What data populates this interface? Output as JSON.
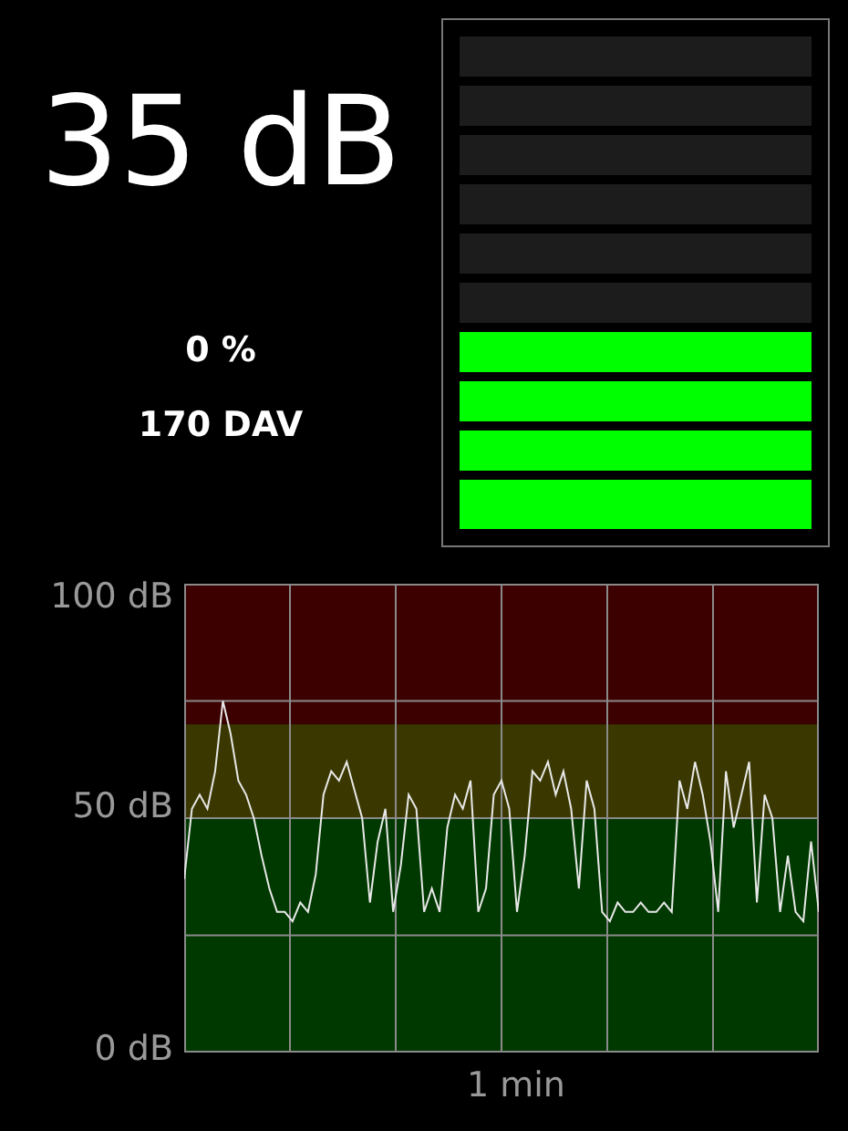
{
  "reading": "35 dB",
  "percent": "0 %",
  "dav": "170 DAV",
  "meter": {
    "level": 0.4
  },
  "chart": {
    "y_labels": [
      "100 dB",
      "50 dB",
      "0 dB"
    ],
    "x_label": "1 min",
    "zones": [
      {
        "color": "#3c0000"
      },
      {
        "color": "#3a3800"
      },
      {
        "color": "#003900"
      }
    ]
  }
}
